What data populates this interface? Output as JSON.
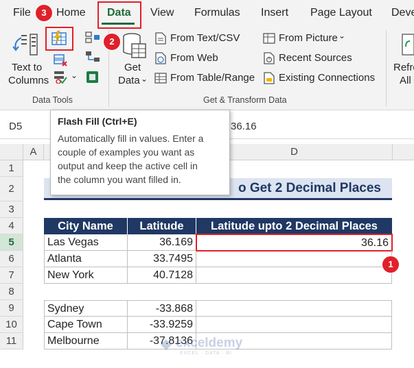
{
  "ribbon": {
    "tabs": [
      {
        "label": "File"
      },
      {
        "label": "Home"
      },
      {
        "label": "Data"
      },
      {
        "label": "View"
      },
      {
        "label": "Formulas"
      },
      {
        "label": "Insert"
      },
      {
        "label": "Page Layout"
      },
      {
        "label": "Devel"
      }
    ],
    "active_tab": "Data",
    "data_tools": {
      "text_to_columns_line1": "Text to",
      "text_to_columns_line2": "Columns",
      "group_label": "Data Tools"
    },
    "get_transform": {
      "get_data_line1": "Get",
      "get_data_line2": "Data",
      "from_text_csv": "From Text/CSV",
      "from_web": "From Web",
      "from_table_range": "From Table/Range",
      "from_picture": "From Picture",
      "recent_sources": "Recent Sources",
      "existing_connections": "Existing Connections",
      "group_label": "Get & Transform Data"
    },
    "refresh": {
      "line1": "Refre",
      "line2": "All"
    }
  },
  "badges": {
    "one": "1",
    "two": "2",
    "three": "3"
  },
  "formula_bar": {
    "name_box": "D5",
    "formula_visible": "36.16"
  },
  "tooltip": {
    "title": "Flash Fill (Ctrl+E)",
    "lines": [
      "Automatically fill in values. Enter a",
      "couple of examples you want as",
      "output and keep the active cell in",
      "the column you want filled in."
    ]
  },
  "sheet": {
    "columns": [
      "A",
      "B",
      "C",
      "D"
    ],
    "rows": [
      "1",
      "2",
      "3",
      "4",
      "5",
      "6",
      "7",
      "8",
      "9",
      "10",
      "11"
    ],
    "title_visible": "o Get 2 Decimal Places",
    "headers": [
      "City Name",
      "Latitude",
      "Latitude upto 2 Decimal Places"
    ],
    "data": [
      {
        "city": "Las Vegas",
        "lat": "36.169",
        "result": "36.16"
      },
      {
        "city": "Atlanta",
        "lat": "33.7495",
        "result": ""
      },
      {
        "city": "New York",
        "lat": "40.7128",
        "result": ""
      },
      {
        "city": "Sydney",
        "lat": "-33.868",
        "result": ""
      },
      {
        "city": "Cape Town",
        "lat": "-33.9259",
        "result": ""
      },
      {
        "city": "Melbourne",
        "lat": "-37.8136",
        "result": ""
      }
    ]
  },
  "watermark": {
    "name": "exceldemy",
    "tagline": "EXCEL · DATA · BI"
  },
  "colors": {
    "excel_green": "#1e6b3a",
    "header_navy": "#203864",
    "annotation_red": "#e0202a",
    "title_band": "#dce3f1"
  }
}
